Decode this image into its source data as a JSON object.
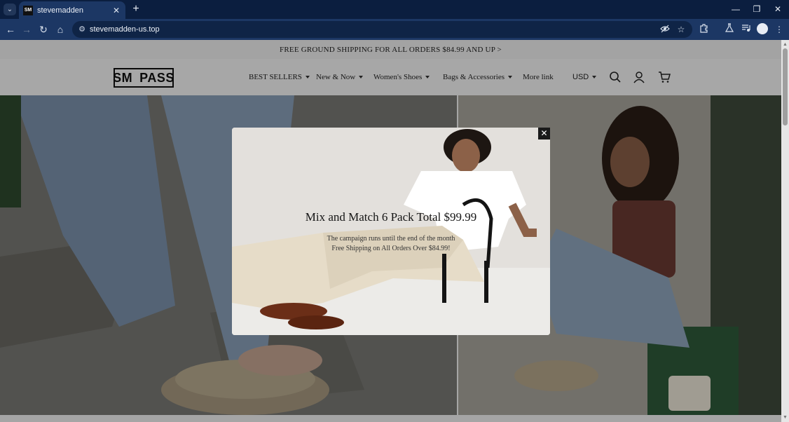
{
  "browser": {
    "tab_title": "stevemadden",
    "favicon_text": "SM",
    "url": "stevemadden-us.top",
    "new_tab": "+",
    "close_tab": "✕"
  },
  "page": {
    "announcement": "FREE GROUND SHIPPING FOR ALL ORDERS $84.99 AND UP >",
    "logo": {
      "left": "SM",
      "right": "PASS"
    },
    "nav": [
      {
        "label": "BEST SELLERS",
        "dropdown": true
      },
      {
        "label": "New & Now",
        "dropdown": true
      },
      {
        "label": "Women's Shoes",
        "dropdown": true
      },
      {
        "label": "Bags & Accessories",
        "dropdown": true
      },
      {
        "label": "More link",
        "dropdown": false
      }
    ],
    "currency": "USD"
  },
  "modal": {
    "title": "Mix and Match 6 Pack Total $99.99",
    "line1": "The campaign runs until the end of the month",
    "line2": "Free Shipping on All Orders Over $84.99!",
    "close": "✕"
  },
  "colors": {
    "chrome_bg": "#0b1e3f",
    "toolbar_bg": "#1c3764",
    "header_bg": "#f7f7f7"
  }
}
